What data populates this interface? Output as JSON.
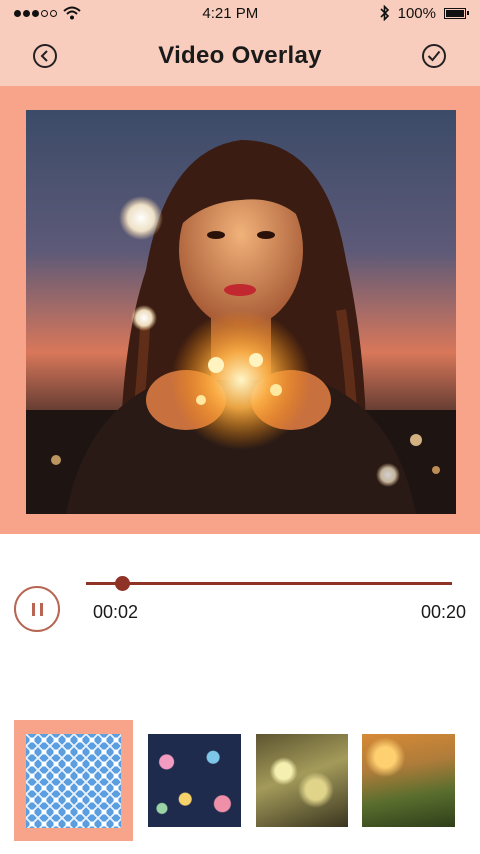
{
  "status_bar": {
    "time": "4:21 PM",
    "battery": "100%",
    "icons": [
      "signal-dots-icon",
      "wifi-icon",
      "bluetooth-icon",
      "battery-icon"
    ]
  },
  "header": {
    "title": "Video Overlay",
    "back_icon": "chevron-left-circle-icon",
    "done_icon": "check-circle-icon"
  },
  "player": {
    "current_time": "00:02",
    "total_time": "00:20",
    "progress": 0.1,
    "state_icon": "pause-icon"
  },
  "overlays": {
    "items": [
      "blue-pattern",
      "floral-pattern",
      "bokeh-light",
      "golden-field"
    ],
    "selected_index": 0
  },
  "colors": {
    "header_bg": "#f9cdbd",
    "frame_bg": "#f8a48b",
    "accent": "#8e3326"
  }
}
